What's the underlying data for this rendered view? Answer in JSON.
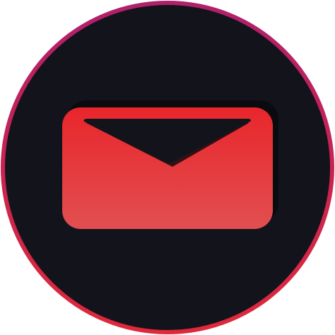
{
  "icon": {
    "name": "mail-envelope",
    "colors": {
      "ring_top": "#b0206c",
      "ring_bottom": "#e0283a",
      "disc": "#13141b",
      "envelope_top": "#e8262c",
      "envelope_bottom": "#e24f50",
      "shadow": "#07080b"
    }
  }
}
